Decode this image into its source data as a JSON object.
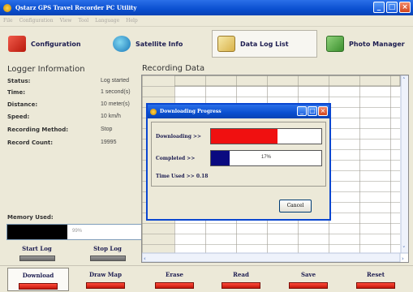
{
  "window": {
    "title": "Qstarz GPS Travel Recorder PC Utility"
  },
  "menu": [
    "File",
    "Configuration",
    "View",
    "Tool",
    "Language",
    "Help"
  ],
  "toolbar": [
    {
      "label": "Configuration",
      "icon": "configuration-icon"
    },
    {
      "label": "Satellite Info",
      "icon": "satellite-globe-icon"
    },
    {
      "label": "Data Log List",
      "icon": "data-log-notebook-icon"
    },
    {
      "label": "Photo Manager",
      "icon": "photo-manager-icon"
    }
  ],
  "logger": {
    "title": "Logger Information",
    "rows": [
      {
        "label": "Status:",
        "value": "Log started"
      },
      {
        "label": "Time:",
        "value": "1 second(s)"
      },
      {
        "label": "Distance:",
        "value": "10 meter(s)"
      },
      {
        "label": "Speed:",
        "value": "10 km/h"
      },
      {
        "label": "Recording Method:",
        "value": "Stop"
      },
      {
        "label": "Record Count:",
        "value": "19995"
      }
    ],
    "memory_label": "Memory Used:",
    "memory_text": "99%",
    "memory_fraction": 0.45,
    "start_log": "Start Log",
    "stop_log": "Stop Log"
  },
  "recording": {
    "title": "Recording Data"
  },
  "dialog": {
    "title": "Downloading Progress",
    "downloading_label": "Downloading >>",
    "downloading_fraction": 0.6,
    "completed_label": "Completed >>",
    "completed_text": "17%",
    "completed_fraction": 0.17,
    "time_used": "Time Used >> 0.18",
    "cancel": "Cancel"
  },
  "bottom": [
    "Download",
    "Draw Map",
    "Erase",
    "Read",
    "Save",
    "Reset"
  ],
  "colors": {
    "title_blue": "#0a4fd0",
    "progress_red": "#f01010",
    "progress_navy": "#0a0a80",
    "led_red": "#d42010"
  }
}
